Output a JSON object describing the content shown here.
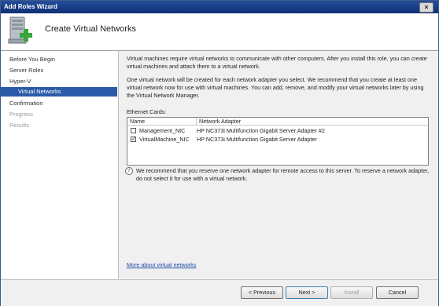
{
  "window": {
    "title": "Add Roles Wizard",
    "close_label": "×"
  },
  "header": {
    "title": "Create Virtual Networks",
    "icon": "server-add-icon"
  },
  "nav": [
    {
      "label": "Before You Begin",
      "state": "normal"
    },
    {
      "label": "Server Roles",
      "state": "normal"
    },
    {
      "label": "Hyper-V",
      "state": "normal"
    },
    {
      "label": "Virtual Networks",
      "state": "active"
    },
    {
      "label": "Confirmation",
      "state": "normal"
    },
    {
      "label": "Progress",
      "state": "disabled"
    },
    {
      "label": "Results",
      "state": "disabled"
    }
  ],
  "content": {
    "intro": "Virtual machines require virtual networks to communicate with other computers. After you install this role, you can create virtual machines and attach them to a virtual network.",
    "description": "One virtual network will be created for each network adapter you select. We recommend that you create at least one virtual network now for use with virtual machines. You can add, remove, and modify your virtual networks later by using the Virtual Network Manager.",
    "cards_label": "Ethernet Cards:",
    "columns": {
      "name": "Name",
      "adapter": "Network Adapter"
    },
    "rows": [
      {
        "name": "Management_NIC",
        "adapter": "HP NC373i Multifunction Gigabit Server Adapter #2",
        "checked": false
      },
      {
        "name": "VirtualMachine_NIC",
        "adapter": "HP NC373i Multifunction Gigabit Server Adapter",
        "checked": true
      }
    ],
    "info_icon": "i",
    "info": "We recommend that you reserve one network adapter for remote access to this server. To reserve a network adapter, do not select it for use with a virtual network.",
    "more_link": "More about virtual networks"
  },
  "buttons": {
    "previous": "< Previous",
    "next": "Next >",
    "install": "Install",
    "cancel": "Cancel"
  },
  "colors": {
    "titlebar": "#244e9b",
    "nav_active": "#2b5aa8",
    "link": "#1a4ba8"
  }
}
